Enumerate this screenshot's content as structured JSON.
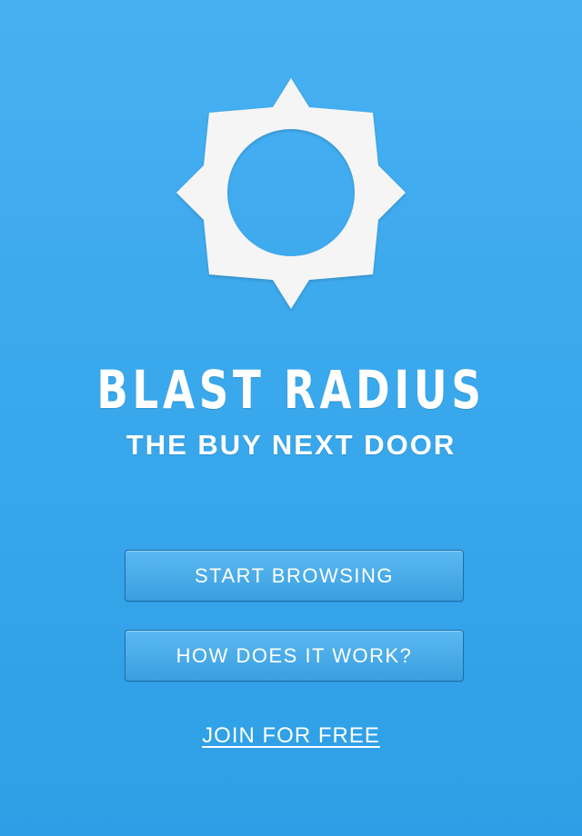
{
  "app": {
    "title": "BLAST RADIUS",
    "tagline": "THE BUY NEXT DOOR",
    "logo_icon": "sun-icon"
  },
  "actions": {
    "start_label": "START BROWSING",
    "how_label": "HOW DOES IT WORK?",
    "join_label": "JOIN FOR FREE"
  },
  "colors": {
    "background_top": "#47b0f2",
    "background_bottom": "#2e9fe6",
    "button_border": "#1d6fa8",
    "text": "#ffffff",
    "logo": "#f5f5f5"
  }
}
